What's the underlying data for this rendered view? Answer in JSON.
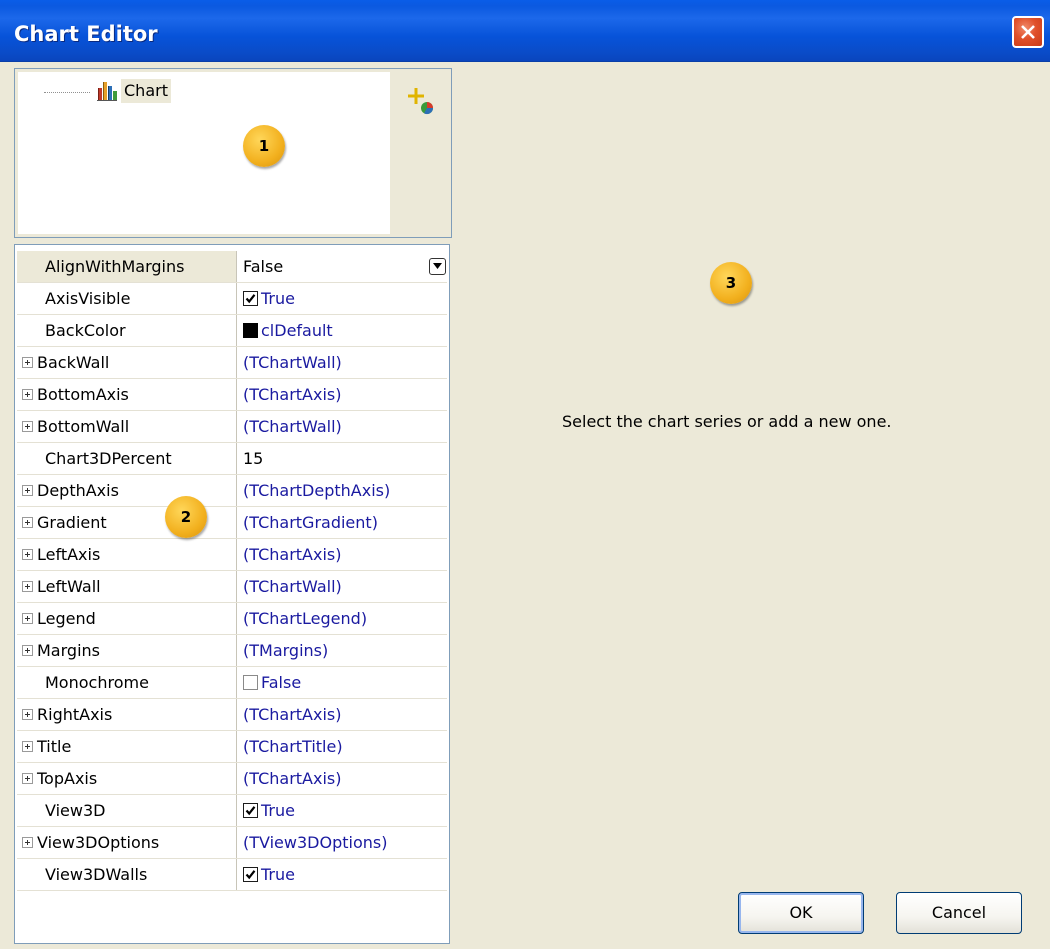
{
  "window": {
    "title": "Chart Editor"
  },
  "tree": {
    "root_label": "Chart",
    "icons": [
      "chart-icon",
      "add-series-icon"
    ]
  },
  "badges": {
    "tree": "1",
    "grid": "2",
    "series": "3"
  },
  "properties": [
    {
      "name": "AlignWithMargins",
      "value": "False",
      "kind": "dropdown",
      "expandable": false,
      "selected": true
    },
    {
      "name": "AxisVisible",
      "value": "True",
      "kind": "checkbox",
      "checked": true,
      "expandable": false
    },
    {
      "name": "BackColor",
      "value": "clDefault",
      "kind": "color",
      "color": "#000000",
      "expandable": false
    },
    {
      "name": "BackWall",
      "value": "(TChartWall)",
      "kind": "object",
      "expandable": true
    },
    {
      "name": "BottomAxis",
      "value": "(TChartAxis)",
      "kind": "object",
      "expandable": true
    },
    {
      "name": "BottomWall",
      "value": "(TChartWall)",
      "kind": "object",
      "expandable": true
    },
    {
      "name": "Chart3DPercent",
      "value": "15",
      "kind": "number",
      "expandable": false
    },
    {
      "name": "DepthAxis",
      "value": "(TChartDepthAxis)",
      "kind": "object",
      "expandable": true
    },
    {
      "name": "Gradient",
      "value": "(TChartGradient)",
      "kind": "object",
      "expandable": true
    },
    {
      "name": "LeftAxis",
      "value": "(TChartAxis)",
      "kind": "object",
      "expandable": true
    },
    {
      "name": "LeftWall",
      "value": "(TChartWall)",
      "kind": "object",
      "expandable": true
    },
    {
      "name": "Legend",
      "value": "(TChartLegend)",
      "kind": "object",
      "expandable": true
    },
    {
      "name": "Margins",
      "value": "(TMargins)",
      "kind": "object",
      "expandable": true
    },
    {
      "name": "Monochrome",
      "value": "False",
      "kind": "checkbox",
      "checked": false,
      "expandable": false
    },
    {
      "name": "RightAxis",
      "value": "(TChartAxis)",
      "kind": "object",
      "expandable": true
    },
    {
      "name": "Title",
      "value": "(TChartTitle)",
      "kind": "object",
      "expandable": true
    },
    {
      "name": "TopAxis",
      "value": "(TChartAxis)",
      "kind": "object",
      "expandable": true
    },
    {
      "name": "View3D",
      "value": "True",
      "kind": "checkbox",
      "checked": true,
      "expandable": false
    },
    {
      "name": "View3DOptions",
      "value": "(TView3DOptions)",
      "kind": "object",
      "expandable": true
    },
    {
      "name": "View3DWalls",
      "value": "True",
      "kind": "checkbox",
      "checked": true,
      "expandable": false
    }
  ],
  "series_panel": {
    "hint": "Select the chart series or add a new one."
  },
  "buttons": {
    "ok": "OK",
    "cancel": "Cancel"
  },
  "colors": {
    "title_bar": "#0a5de8",
    "window_bg": "#ece9d8",
    "link_value": "#1a1aa0",
    "badge": "#f2b01e"
  }
}
